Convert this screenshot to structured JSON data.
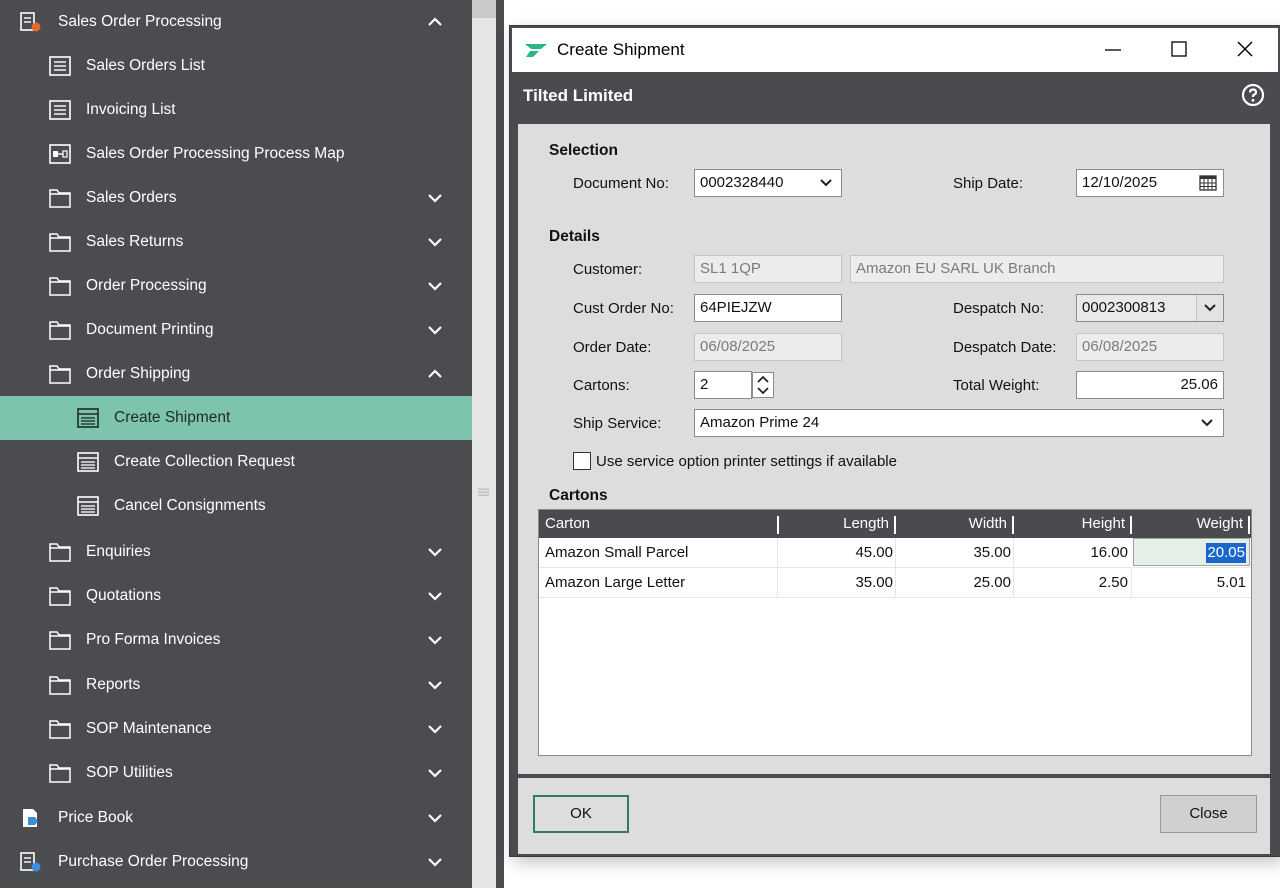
{
  "sidebar": {
    "items": [
      {
        "label": "Sales Order Processing",
        "icon": "sop-module-icon",
        "chevron": "up"
      },
      {
        "label": "Sales Orders List",
        "icon": "list-icon"
      },
      {
        "label": "Invoicing List",
        "icon": "list-icon"
      },
      {
        "label": "Sales Order Processing Process Map",
        "icon": "process-map-icon"
      },
      {
        "label": "Sales Orders",
        "icon": "folder-icon",
        "chevron": "down"
      },
      {
        "label": "Sales Returns",
        "icon": "folder-icon",
        "chevron": "down"
      },
      {
        "label": "Order Processing",
        "icon": "folder-icon",
        "chevron": "down"
      },
      {
        "label": "Document Printing",
        "icon": "folder-icon",
        "chevron": "down"
      },
      {
        "label": "Order Shipping",
        "icon": "folder-icon",
        "chevron": "up"
      },
      {
        "label": "Create Shipment",
        "icon": "form-icon",
        "active": true
      },
      {
        "label": "Create Collection Request",
        "icon": "form-icon"
      },
      {
        "label": "Cancel Consignments",
        "icon": "form-icon"
      },
      {
        "label": "Enquiries",
        "icon": "folder-icon",
        "chevron": "down"
      },
      {
        "label": "Quotations",
        "icon": "folder-icon",
        "chevron": "down"
      },
      {
        "label": "Pro Forma Invoices",
        "icon": "folder-icon",
        "chevron": "down"
      },
      {
        "label": "Reports",
        "icon": "folder-icon",
        "chevron": "down"
      },
      {
        "label": "SOP Maintenance",
        "icon": "folder-icon",
        "chevron": "down"
      },
      {
        "label": "SOP Utilities",
        "icon": "folder-icon",
        "chevron": "down"
      },
      {
        "label": "Price Book",
        "icon": "price-book-icon",
        "chevron": "down"
      },
      {
        "label": "Purchase Order Processing",
        "icon": "pop-module-icon",
        "chevron": "down"
      }
    ]
  },
  "dialog": {
    "title": "Create Shipment",
    "company": "Tilted Limited",
    "sections": {
      "selection": "Selection",
      "details": "Details",
      "cartons": "Cartons"
    },
    "labels": {
      "document_no": "Document No:",
      "ship_date": "Ship Date:",
      "customer": "Customer:",
      "cust_order_no": "Cust Order No:",
      "despatch_no": "Despatch No:",
      "order_date": "Order Date:",
      "despatch_date": "Despatch Date:",
      "cartons": "Cartons:",
      "total_weight": "Total Weight:",
      "ship_service": "Ship Service:",
      "use_printer_settings": "Use service option printer settings if available"
    },
    "values": {
      "document_no": "0002328440",
      "ship_date": "12/10/2025",
      "customer_code": "SL1 1QP",
      "customer_name": "Amazon EU SARL UK Branch",
      "cust_order_no": "64PIEJZW",
      "despatch_no": "0002300813",
      "order_date": "06/08/2025",
      "despatch_date": "06/08/2025",
      "cartons": "2",
      "total_weight": "25.06",
      "ship_service": "Amazon Prime 24",
      "use_printer_settings": false
    },
    "grid": {
      "columns": [
        "Carton",
        "Length",
        "Width",
        "Height",
        "Weight"
      ],
      "rows": [
        {
          "carton": "Amazon Small Parcel",
          "length": "45.00",
          "width": "35.00",
          "height": "16.00",
          "weight": "20.05"
        },
        {
          "carton": "Amazon Large Letter",
          "length": "35.00",
          "width": "25.00",
          "height": "2.50",
          "weight": "5.01"
        }
      ]
    },
    "buttons": {
      "ok": "OK",
      "close": "Close"
    }
  },
  "colors": {
    "sidebar_bg": "#4b4c50",
    "active_item_bg": "#7dc3ad",
    "dialog_frame": "#4a4b4f",
    "dialog_body": "#dddddd",
    "ok_border": "#2e7d64",
    "selection": "#1a66cc",
    "brand": "#2bb68a"
  }
}
